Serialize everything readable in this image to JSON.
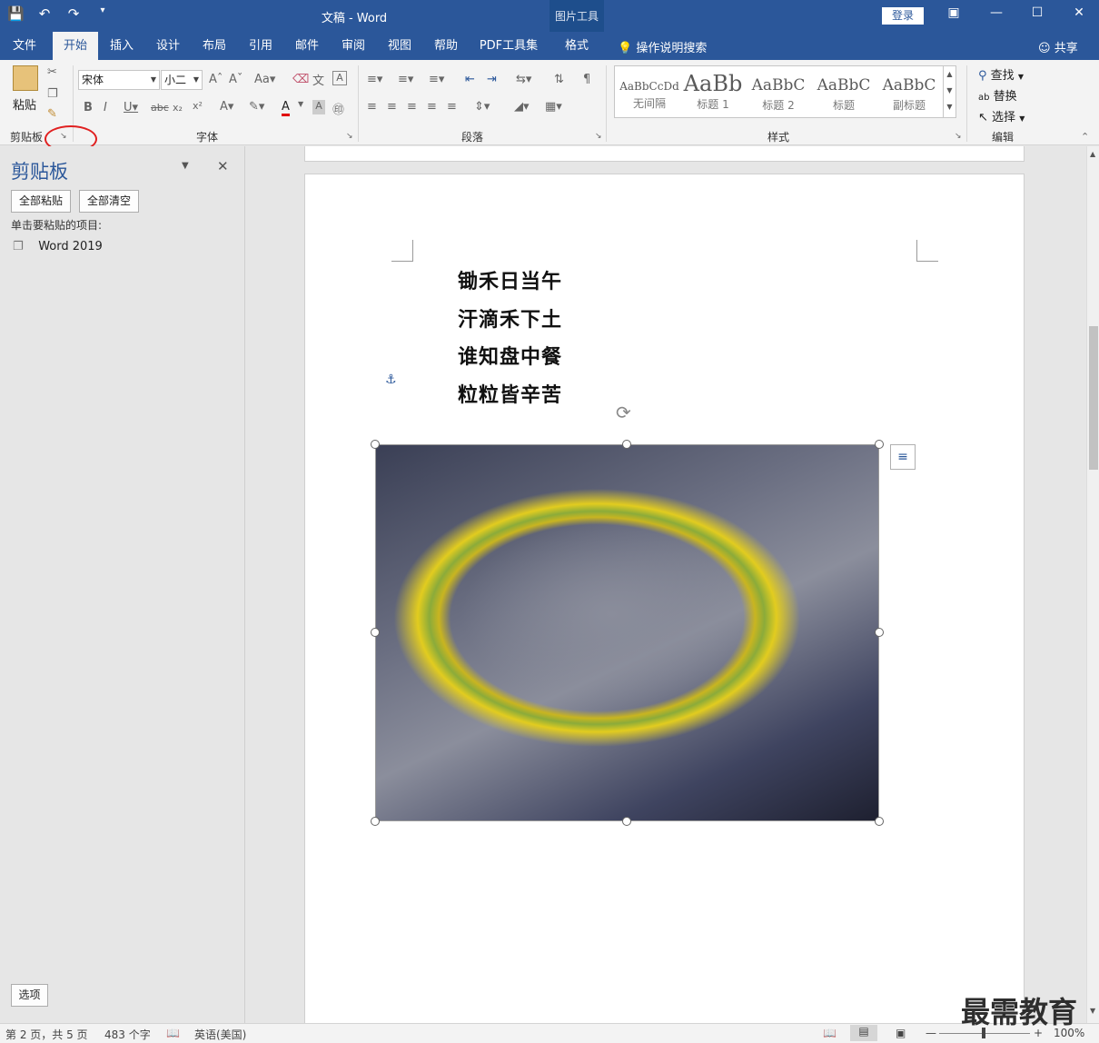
{
  "titlebar": {
    "doc_title": "文稿  -  Word",
    "context_tab_group": "图片工具",
    "login": "登录"
  },
  "tabs": [
    {
      "label": "文件"
    },
    {
      "label": "开始",
      "active": true
    },
    {
      "label": "插入"
    },
    {
      "label": "设计"
    },
    {
      "label": "布局"
    },
    {
      "label": "引用"
    },
    {
      "label": "邮件"
    },
    {
      "label": "审阅"
    },
    {
      "label": "视图"
    },
    {
      "label": "帮助"
    },
    {
      "label": "PDF工具集"
    },
    {
      "label": "格式"
    }
  ],
  "tellme": "操作说明搜索",
  "share": "共享",
  "ribbon": {
    "clipboard": {
      "paste_label": "粘贴",
      "group_label": "剪贴板"
    },
    "font": {
      "font_name": "宋体",
      "font_size": "小二",
      "group_label": "字体"
    },
    "paragraph": {
      "group_label": "段落"
    },
    "styles": {
      "group_label": "样式",
      "items": [
        {
          "sample": "AaBbCcDd",
          "name": "无间隔"
        },
        {
          "sample": "AaBb",
          "name": "标题 1"
        },
        {
          "sample": "AaBbC",
          "name": "标题 2"
        },
        {
          "sample": "AaBbC",
          "name": "标题"
        },
        {
          "sample": "AaBbC",
          "name": "副标题"
        }
      ]
    },
    "editing": {
      "find": "查找",
      "replace": "替换",
      "select": "选择",
      "group_label": "编辑"
    }
  },
  "clipboard_pane": {
    "title": "剪贴板",
    "paste_all": "全部粘贴",
    "clear_all": "全部清空",
    "hint": "单击要粘贴的项目:",
    "items": [
      "Word 2019"
    ],
    "options": "选项"
  },
  "document": {
    "poem": [
      "锄禾日当午",
      "汗滴禾下土",
      "谁知盘中餐",
      "粒粒皆辛苦"
    ]
  },
  "status": {
    "page": "第 2 页，共 5 页",
    "words": "483 个字",
    "language": "英语(美国)",
    "zoom": "100%"
  },
  "watermark": "最需教育"
}
